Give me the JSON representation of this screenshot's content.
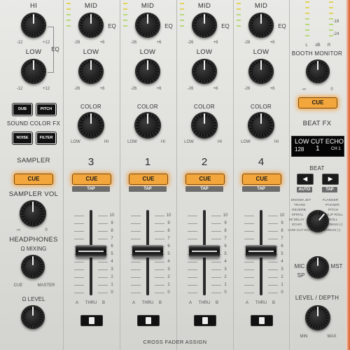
{
  "hp": {
    "hi_label": "HI",
    "low_label": "LOW",
    "hi_min": "-12",
    "hi_max": "+12",
    "low_min": "-12",
    "low_max": "+12",
    "eq_label": "EQ",
    "sound_color_fx": "SOUND COLOR FX",
    "fx_buttons": [
      "DUB ECHO",
      "PITCH",
      "NOISE",
      "FILTER"
    ],
    "sampler": "SAMPLER",
    "cue": "CUE",
    "sampler_vol": "SAMPLER VOL",
    "vol_min": "-∞",
    "vol_max": "0",
    "headphones": "HEADPHONES",
    "mixing": "MIXING",
    "mix_min": "CUE",
    "mix_max": "MASTER",
    "level": "LEVEL"
  },
  "channels": [
    {
      "mid": "MID",
      "low": "LOW",
      "eq": "EQ",
      "mid_min": "-26",
      "mid_max": "+6",
      "low_min": "-26",
      "low_max": "+6",
      "color": "COLOR",
      "color_min": "LOW",
      "color_max": "HI",
      "number": "3",
      "cue": "CUE",
      "tap": "TAP"
    },
    {
      "mid": "MID",
      "low": "LOW",
      "eq": "EQ",
      "mid_min": "-26",
      "mid_max": "+6",
      "low_min": "-26",
      "low_max": "+6",
      "color": "COLOR",
      "color_min": "LOW",
      "color_max": "HI",
      "number": "1",
      "cue": "CUE",
      "tap": "TAP"
    },
    {
      "mid": "MID",
      "low": "LOW",
      "eq": "EQ",
      "mid_min": "-26",
      "mid_max": "+6",
      "low_min": "-26",
      "low_max": "+6",
      "color": "COLOR",
      "color_min": "LOW",
      "color_max": "HI",
      "number": "2",
      "cue": "CUE",
      "tap": "TAP"
    },
    {
      "mid": "MID",
      "low": "LOW",
      "eq": "EQ",
      "mid_min": "-26",
      "mid_max": "+6",
      "low_min": "-26",
      "low_max": "+6",
      "color": "COLOR",
      "color_min": "LOW",
      "color_max": "HI",
      "number": "4",
      "cue": "CUE",
      "tap": "TAP"
    }
  ],
  "fader_scale": [
    "10",
    "9",
    "8",
    "7",
    "6",
    "5",
    "4",
    "3",
    "2",
    "1",
    "0"
  ],
  "crossfader_assign": {
    "a": "A",
    "thru": "THRU",
    "b": "B",
    "title": "CROSS FADER ASSIGN"
  },
  "fx": {
    "meter_labels": [
      "-18",
      "-24"
    ],
    "meter_bottom": [
      "L",
      "dB",
      "R"
    ],
    "booth_monitor": "BOOTH MONITOR",
    "booth_min": "-∞",
    "booth_max": "0",
    "cue": "CUE",
    "beat_fx": "BEAT FX",
    "display_line1": "LOW CUT ECHO",
    "display_auto": "AUTO",
    "display_bpm": "128",
    "display_beat": "1",
    "display_ch": "CH 1",
    "beat": "BEAT",
    "auto": "AUTO",
    "tap": "TAP",
    "effects": [
      "ENIGMA JET",
      "FLANGER",
      "TRANS",
      "PHASER",
      "REVERB",
      "PITCH",
      "SPIRAL",
      "SLIP ROLL",
      "M/ DELAY",
      "ROLL",
      "ECHO",
      "MOBIUS (-)",
      "LOW CUT ECHO",
      "MOBIUS (-)"
    ],
    "mic": "MIC",
    "mst": "MST",
    "sp": "SP",
    "level_depth": "LEVEL / DEPTH",
    "ld_min": "MIN",
    "ld_max": "MAX"
  }
}
